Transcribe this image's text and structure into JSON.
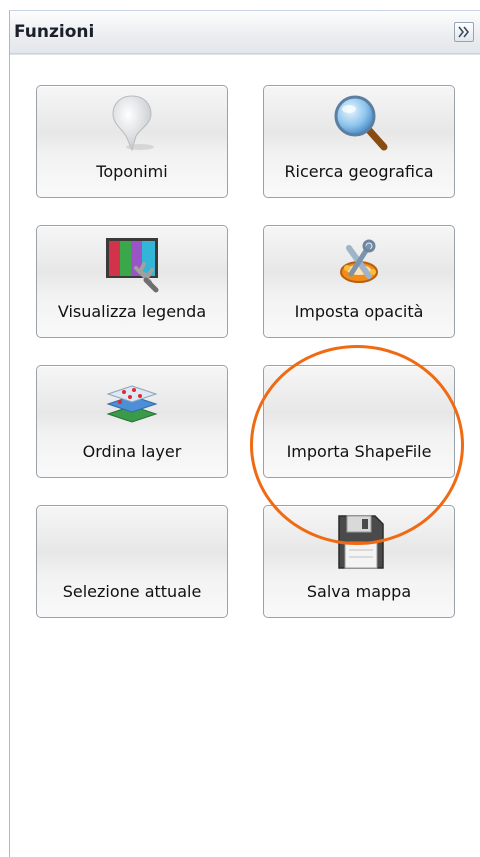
{
  "panel": {
    "title": "Funzioni",
    "collapse_glyph": "»"
  },
  "buttons": [
    {
      "label": "Toponimi",
      "icon": "map-pin-icon"
    },
    {
      "label": "Ricerca geografica",
      "icon": "magnifier-icon"
    },
    {
      "label": "Visualizza legenda",
      "icon": "legend-color-bars-icon"
    },
    {
      "label": "Imposta opacità",
      "icon": "opacity-tools-icon"
    },
    {
      "label": "Ordina layer",
      "icon": "layer-stack-icon"
    },
    {
      "label": "Importa ShapeFile",
      "icon": ""
    },
    {
      "label": "Selezione attuale",
      "icon": ""
    },
    {
      "label": "Salva mappa",
      "icon": "floppy-disk-icon"
    }
  ],
  "colors": {
    "highlight": "#ef6a12",
    "panel_border": "#99bbe8"
  }
}
